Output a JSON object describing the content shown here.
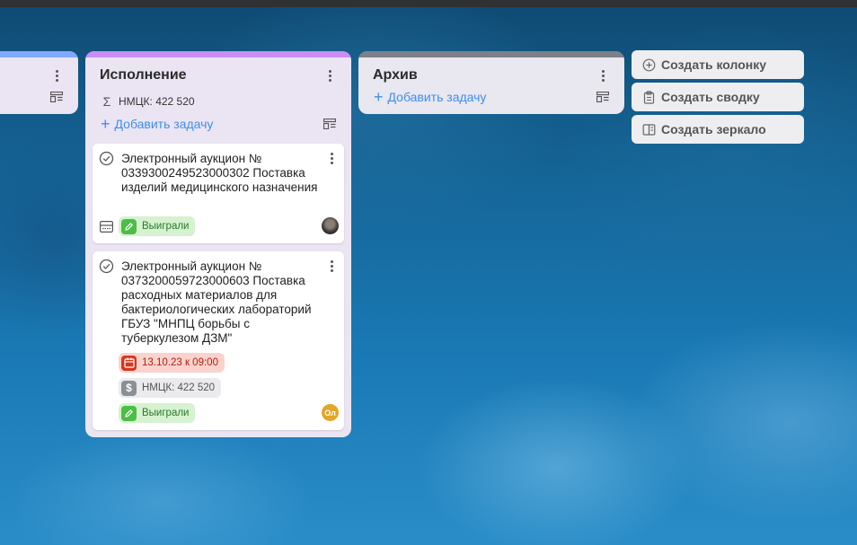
{
  "columns": {
    "partial": {},
    "execution": {
      "title": "Исполнение",
      "sum_label": "НМЦК: 422 520",
      "add_task_label": "Добавить задачу"
    },
    "archive": {
      "title": "Архив",
      "add_task_label": "Добавить задачу"
    }
  },
  "cards": [
    {
      "title": "Электронный аукцион № 0339300249523000302 Поставка изделий медицинского назначения",
      "status_badge": "Выиграли",
      "avatar": "photo"
    },
    {
      "title": "Электронный аукцион № 0373200059723000603 Поставка расходных материалов для бактериологических лабораторий ГБУЗ \"МНПЦ борьбы с туберкулезом ДЗМ\"",
      "date_badge": "13.10.23 к 09:00",
      "sum_badge": "НМЦК: 422 520",
      "status_badge": "Выиграли",
      "avatar_initials": "Ол"
    }
  ],
  "actions": {
    "create_column": "Создать колонку",
    "create_summary": "Создать сводку",
    "create_mirror": "Создать зеркало"
  },
  "colors": {
    "execution_stripe": "#c98df5",
    "archive_stripe": "#7d8088",
    "partial_stripe": "#7fa9ff",
    "win_badge": "#4cbd46",
    "date_badge": "#d6361f",
    "link_blue": "#3d8ef0"
  },
  "icons": {
    "sum": "sigma-icon",
    "add": "plus-icon",
    "layout": "layout-icon",
    "check": "check-circle-icon",
    "win": "pencil-icon",
    "date": "calendar-icon",
    "money": "dollar-icon",
    "create_column": "plus-circle-icon",
    "create_summary": "clipboard-icon",
    "create_mirror": "mirror-icon"
  }
}
